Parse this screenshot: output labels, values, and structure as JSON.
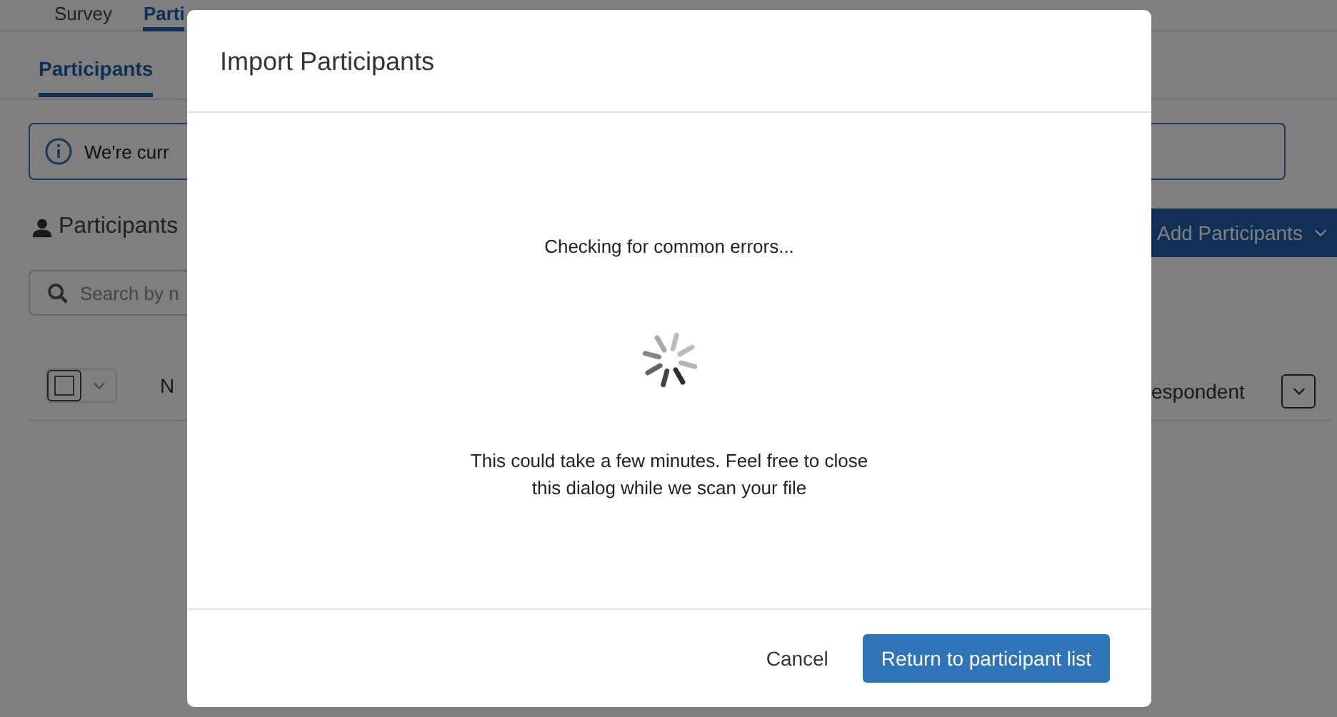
{
  "top_tabs": [
    {
      "label": "Survey",
      "selected": false
    },
    {
      "label": "Parti",
      "selected": true
    }
  ],
  "sub_tabs": [
    {
      "label": "Participants",
      "selected": true
    }
  ],
  "info_banner": {
    "text": "We're curr"
  },
  "heading": "Participants",
  "add_button": {
    "label": "Add Participants"
  },
  "search": {
    "placeholder": "Search by n"
  },
  "table_header": {
    "select_all_checked": false,
    "column_1": "N",
    "column_2": "espondent"
  },
  "dialog": {
    "title": "Import Participants",
    "status": "Checking for common errors...",
    "message": "This could take a few minutes. Feel free to close this dialog while we scan your file",
    "buttons": [
      {
        "label": "Cancel",
        "kind": "link"
      },
      {
        "label": "Return to participant list",
        "kind": "primary"
      }
    ]
  }
}
